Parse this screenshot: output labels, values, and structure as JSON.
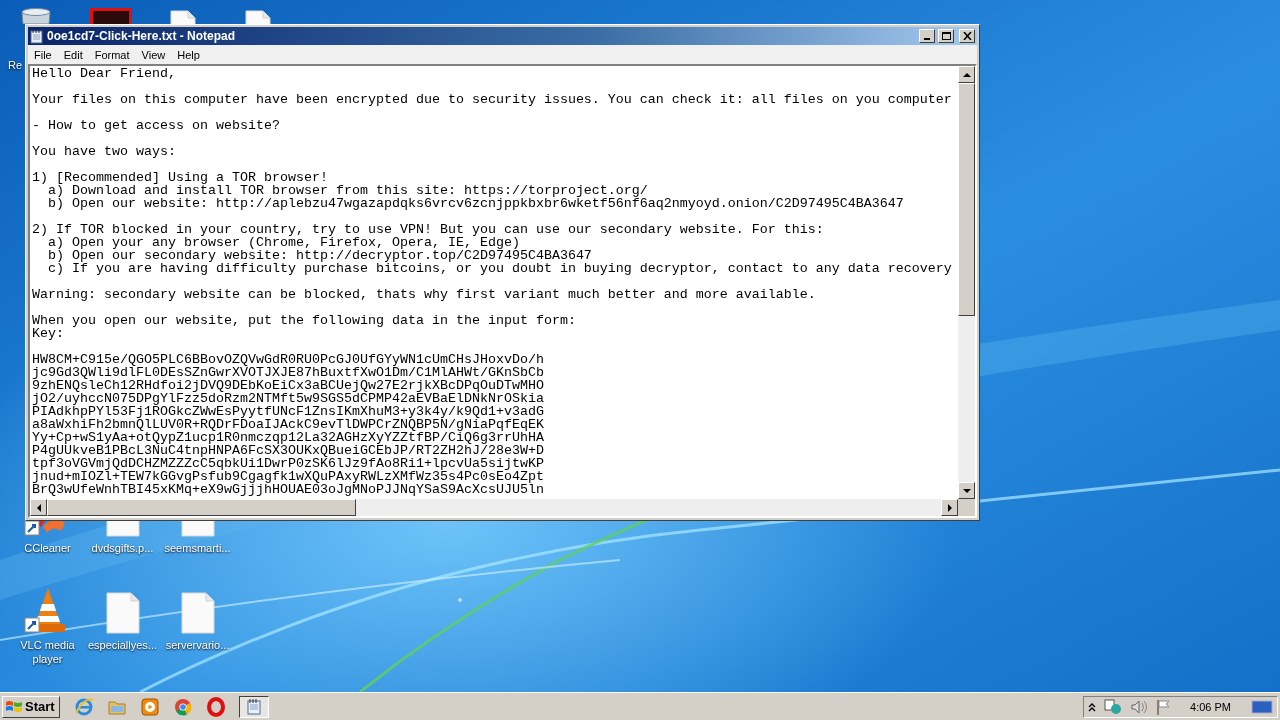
{
  "desktop": {
    "icons": [
      {
        "kind": "recycle",
        "label": "Re"
      },
      {
        "kind": "red-app"
      },
      {
        "kind": "file"
      },
      {
        "kind": "file"
      },
      {
        "kind": "ccleaner",
        "label": "CCleaner"
      },
      {
        "kind": "file",
        "label": "dvdsgifts.p..."
      },
      {
        "kind": "file",
        "label": "seemsmarti..."
      },
      {
        "kind": "vlc",
        "label": "VLC media player"
      },
      {
        "kind": "file",
        "label": "especiallyes..."
      },
      {
        "kind": "file",
        "label": "servervario..."
      }
    ]
  },
  "window": {
    "title": "0oe1cd7-Click-Here.txt - Notepad",
    "menu": [
      "File",
      "Edit",
      "Format",
      "View",
      "Help"
    ],
    "blocks": [
      [
        "Hello Dear Friend,"
      ],
      [
        "Your files on this computer have been encrypted due to security issues. You can check it: all files on you computer"
      ],
      [
        "- How to get access on website?"
      ],
      [
        "You have two ways:"
      ],
      [
        "1) [Recommended] Using a TOR browser!",
        "  a) Download and install TOR browser from this site: https://torproject.org/",
        "  b) Open our website: http://aplebzu47wgazapdqks6vrcv6zcnjppkbxbr6wketf56nf6aq2nmyoyd.onion/C2D97495C4BA3647"
      ],
      [
        "2) If TOR blocked in your country, try to use VPN! But you can use our secondary website. For this:",
        "  a) Open your any browser (Chrome, Firefox, Opera, IE, Edge)",
        "  b) Open our secondary website: http://decryptor.top/C2D97495C4BA3647",
        "  c) If you are having difficulty purchase bitcoins, or you doubt in buying decryptor, contact to any data recovery"
      ],
      [
        "Warning: secondary website can be blocked, thats why first variant much better and more available."
      ],
      [
        "When you open our website, put the following data in the input form:",
        "Key:"
      ],
      [
        "HW8CM+C915e/QGO5PLC6BBovOZQVwGdR0RU0PcGJ0UfGYyWN1cUmCHsJHoxvDo/h",
        "jc9Gd3QWli9dlFL0DEsSZnGwrXVOTJXJE87hBuxtfXwO1Dm/C1MlAHWt/GKnSbCb",
        "9zhENQsleCh12RHdfoi2jDVQ9DEbKoEiCx3aBCUejQw27E2rjkXBcDPqOuDTwMHO",
        "jO2/uyhccN075DPgYlFzz5doRzm2NTMft5w9SGS5dCPMP42aEVBaElDNkNrOSkia",
        "PIAdkhpPYl53Fj1ROGkcZWwEsPyytfUNcF1ZnsIKmXhuM3+y3k4y/k9Qd1+v3adG",
        "a8aWxhiFh2bmnQlLUV0R+RQDrFDoaIJAckC9evTlDWPCrZNQBP5N/gNiaPqfEqEK",
        "Yy+Cp+wS1yAa+otQypZ1ucp1R0nmczqp12La32AGHzXyYZZtfBP/CiQ6g3rrUhHA",
        "P4gUUkveB1PBcL3NuC4tnpHNPA6FcSX3OUKxQBueiGCEbJP/RT2ZH2hJ/28e3W+D",
        "tpf3oVGVmjQdDCHZMZZZcC5qbkUi1DwrP0zSK6lJz9fAo8Ri1+lpcvUa5sijtwKP",
        "jnud+mIOZl+TEW7kGGvgPsfub9Cgagfk1wXQuPAxyRWLzXMfWz35s4Pc0sEo4Zpt",
        "BrQ3wUfeWnhTBI45xKMq+eX9wGjjjhHOUAE03oJgMNoPJJNqYSaS9AcXcsUJU5ln"
      ]
    ]
  },
  "taskbar": {
    "start": "Start",
    "apps": [
      {
        "kind": "ie",
        "selected": false
      },
      {
        "kind": "folder",
        "selected": false
      },
      {
        "kind": "media",
        "selected": false
      },
      {
        "kind": "chrome",
        "selected": false
      },
      {
        "kind": "opera",
        "selected": false
      },
      {
        "kind": "notepad",
        "selected": true
      }
    ],
    "tray": {
      "time": "4:06 PM"
    }
  }
}
